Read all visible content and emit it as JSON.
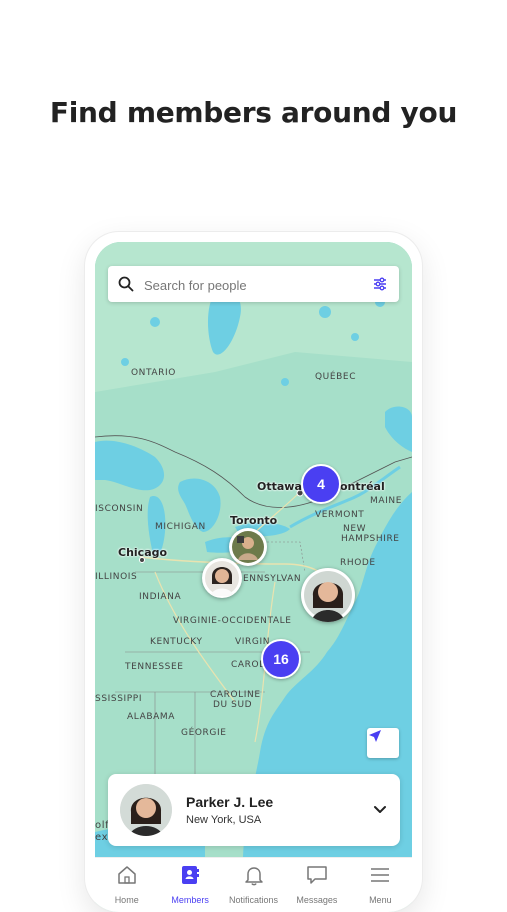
{
  "headline": "Find members around you",
  "search": {
    "placeholder": "Search for people"
  },
  "map": {
    "labels": {
      "ontario": "ONTARIO",
      "quebec": "QUÉBEC",
      "ottawa": "Ottawa",
      "montreal": "ontréal",
      "toronto": "Toronto",
      "wisconsin": "ISCONSIN",
      "michigan": "MICHIGAN",
      "chicago": "Chicago",
      "illinois": "ILLINOIS",
      "indiana": "INDIANA",
      "vermont": "VERMONT",
      "maine": "MAINE",
      "new_hampshire_1": "NEW",
      "new_hampshire_2": "HAMPSHIRE",
      "rhode": "RHODE",
      "pennsylvania": "ENNSYLVAN",
      "virginie_occ": "VIRGINIE-OCCIDENTALE",
      "kentucky": "KENTUCKY",
      "virginia": "VIRGIN",
      "tennessee": "TENNESSEE",
      "carolina_n": "CAROL",
      "mississippi": "SSISSIPPI",
      "carolina_s1": "CAROLINE",
      "carolina_s2": "DU SUD",
      "alabama": "ALABAMA",
      "georgia": "GÉORGIE",
      "olf": "olf",
      "ex": "ex"
    },
    "clusters": {
      "northeast": "4",
      "southeast": "16"
    }
  },
  "member_card": {
    "name": "Parker J. Lee",
    "location": "New York, USA"
  },
  "tabs": [
    {
      "label": "Home",
      "icon": "home-icon"
    },
    {
      "label": "Members",
      "icon": "members-icon"
    },
    {
      "label": "Notifications",
      "icon": "bell-icon"
    },
    {
      "label": "Messages",
      "icon": "message-icon"
    },
    {
      "label": "Menu",
      "icon": "menu-icon"
    }
  ],
  "colors": {
    "accent": "#4a3ff2",
    "water": "#6ecfe3",
    "land": "#9fdcc6"
  }
}
